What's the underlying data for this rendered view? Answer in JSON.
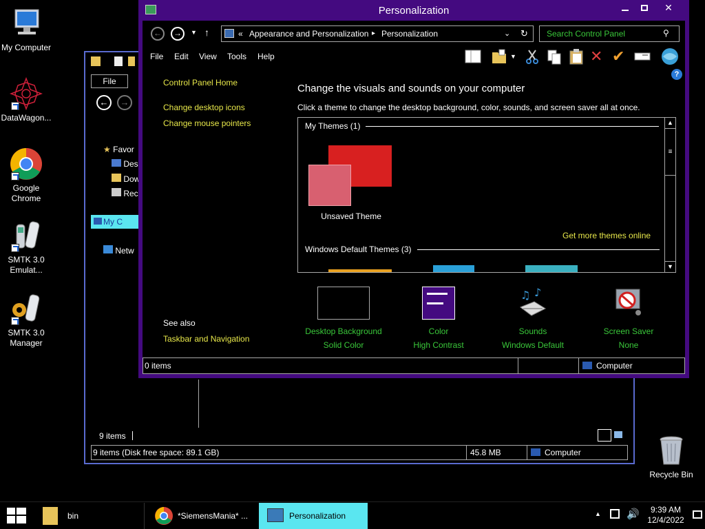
{
  "desktop": {
    "icons": [
      {
        "label": "My Computer"
      },
      {
        "label": "DataWagon..."
      },
      {
        "label": "Google Chrome"
      },
      {
        "label": "SMTK 3.0 Emulat..."
      },
      {
        "label": "SMTK 3.0 Manager"
      },
      {
        "label": "Recycle Bin"
      }
    ]
  },
  "explorer": {
    "file_tab": "File",
    "tree": [
      "Favor",
      "Des",
      "Dow",
      "Rec",
      "My C",
      "Netw"
    ],
    "item_count": "9 items",
    "status": {
      "summary": "9 items (Disk free space: 89.1 GB)",
      "size": "45.8 MB",
      "location": "Computer"
    }
  },
  "window": {
    "title": "Personalization",
    "address": {
      "prefix": "«",
      "part1": "Appearance and Personalization",
      "sep": "▸",
      "part2": "Personalization"
    },
    "search_placeholder": "Search Control Panel",
    "menu": [
      "File",
      "Edit",
      "View",
      "Tools",
      "Help"
    ],
    "left_panel": {
      "home": "Control Panel Home",
      "links": [
        "Change desktop icons",
        "Change mouse pointers"
      ],
      "see_also": "See also",
      "taskbar_link": "Taskbar and Navigation"
    },
    "heading": "Change the visuals and sounds on your computer",
    "subheading": "Click a theme to change the desktop background, color, sounds, and screen saver all at once.",
    "themes": {
      "my_themes": "My Themes (1)",
      "unsaved": "Unsaved Theme",
      "get_more": "Get more themes online",
      "default_themes": "Windows Default Themes (3)"
    },
    "bottom": [
      {
        "title": "Desktop Background",
        "value": "Solid Color"
      },
      {
        "title": "Color",
        "value": "High Contrast"
      },
      {
        "title": "Sounds",
        "value": "Windows Default"
      },
      {
        "title": "Screen Saver",
        "value": "None"
      }
    ],
    "status": {
      "items": "0 items",
      "location": "Computer"
    }
  },
  "taskbar": {
    "buttons": [
      {
        "label": "bin"
      },
      {
        "label": "*SiemensMania* ..."
      },
      {
        "label": "Personalization"
      }
    ],
    "time": "9:39 AM",
    "date": "12/4/2022"
  },
  "colors": {
    "accent": "#440a80",
    "link_green": "#3ac83a",
    "link_yellow": "#e8e84a",
    "task_active": "#5ae6f0"
  }
}
